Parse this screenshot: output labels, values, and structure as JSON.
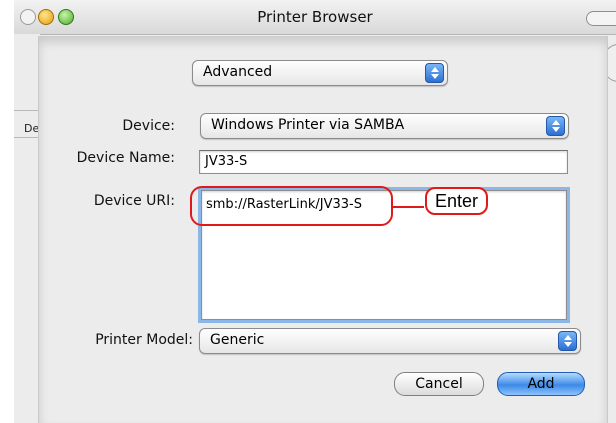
{
  "window": {
    "title": "Printer Browser"
  },
  "background": {
    "left_strip_text": "De"
  },
  "sheet": {
    "mode_popup": {
      "value": "Advanced"
    },
    "device": {
      "label": "Device:",
      "value": "Windows Printer via SAMBA"
    },
    "device_name": {
      "label": "Device Name:",
      "value": "JV33-S"
    },
    "device_uri": {
      "label": "Device URI:",
      "value": "smb://RasterLink/JV33-S"
    },
    "printer_model": {
      "label": "Printer Model:",
      "value": "Generic"
    },
    "buttons": {
      "cancel": "Cancel",
      "add": "Add"
    }
  },
  "annotation": {
    "callout_text": "Enter",
    "color": "#e01a1a"
  },
  "colors": {
    "focus_ring": "#8ab6e8",
    "default_button": "#3c8ae6"
  }
}
